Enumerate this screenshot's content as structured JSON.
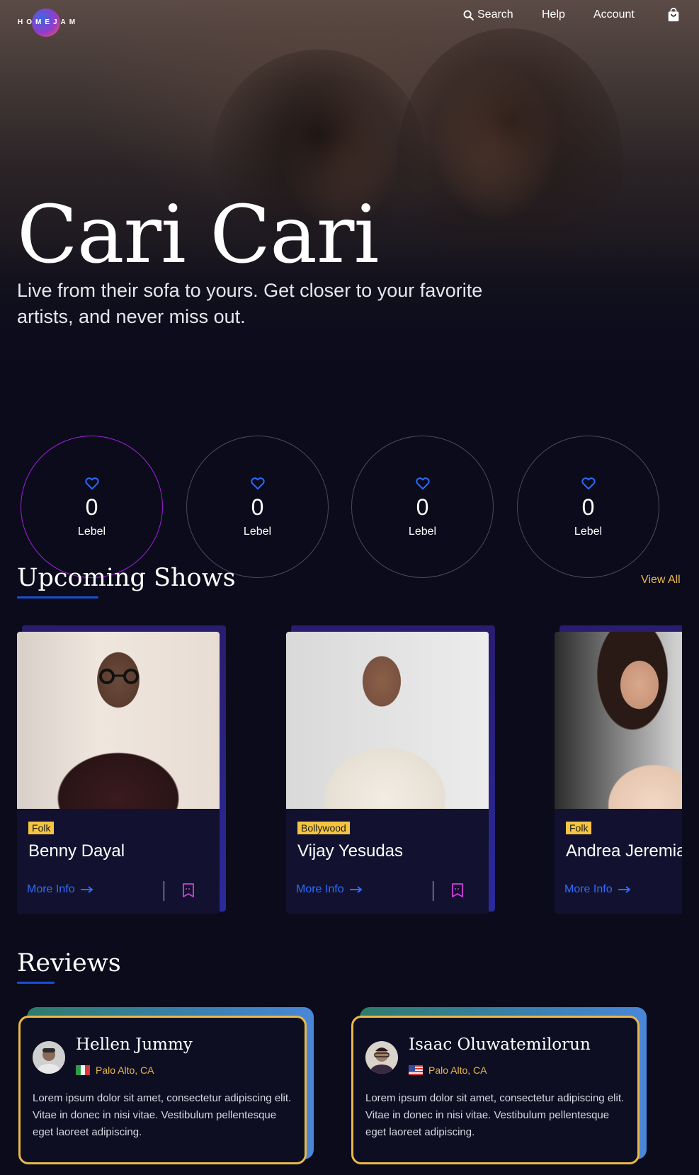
{
  "brand": {
    "logo_text": "HOMEJAM"
  },
  "nav": {
    "search_label": "Search",
    "help_label": "Help",
    "account_label": "Account"
  },
  "hero": {
    "title": "Cari Cari",
    "subtitle": "Live from their sofa to yours. Get closer to your favorite artists, and never miss out."
  },
  "stats": [
    {
      "value": "0",
      "label": "Lebel"
    },
    {
      "value": "0",
      "label": "Lebel"
    },
    {
      "value": "0",
      "label": "Lebel"
    },
    {
      "value": "0",
      "label": "Lebel"
    }
  ],
  "upcoming": {
    "title": "Upcoming Shows",
    "view_all": "View All",
    "shows": [
      {
        "genre": "Folk",
        "name": "Benny Dayal",
        "more_info": "More Info"
      },
      {
        "genre": "Bollywood",
        "name": "Vijay Yesudas",
        "more_info": "More Info"
      },
      {
        "genre": "Folk",
        "name": "Andrea Jeremiah",
        "more_info": "More Info"
      }
    ]
  },
  "reviews": {
    "title": "Reviews",
    "items": [
      {
        "name": "Hellen Jummy",
        "location": "Palo Alto, CA",
        "flag": "italy-flag",
        "text": "Lorem ipsum dolor sit amet, consectetur adipiscing elit. Vitae in donec in nisi vitae. Vestibulum pellentesque eget laoreet adipiscing."
      },
      {
        "name": "Isaac Oluwatemilorun",
        "location": "Palo Alto, CA",
        "flag": "usa-flag",
        "text": "Lorem ipsum dolor sit amet, consectetur adipiscing elit. Vitae in donec in nisi vitae. Vestibulum pellentesque eget laoreet adipiscing."
      }
    ]
  },
  "colors": {
    "background": "#0b0b1c",
    "accent_blue": "#2d6cff",
    "accent_gold": "#e8b84a",
    "accent_purple": "#a020d8",
    "tag_yellow": "#f5c542"
  }
}
